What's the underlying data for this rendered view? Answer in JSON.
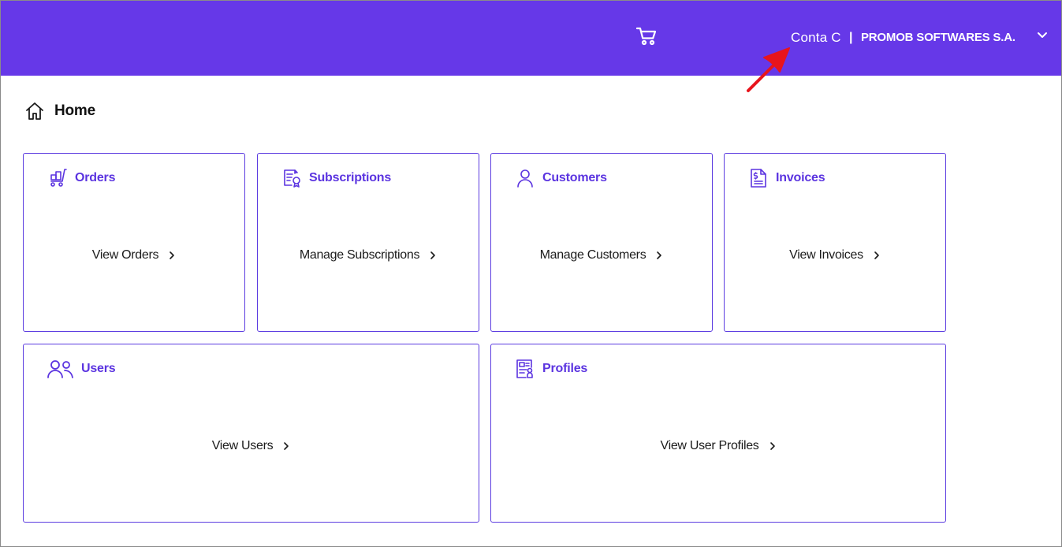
{
  "header": {
    "cart_icon": "shopping-cart-icon",
    "account_label": "Conta C",
    "separator": "|",
    "company_name": "PROMOB SOFTWARES S.A.",
    "dropdown_icon": "chevron-down-icon",
    "background_color": "#6638e8"
  },
  "breadcrumb": {
    "icon": "home-icon",
    "title": "Home"
  },
  "cards": {
    "orders": {
      "title": "Orders",
      "link": "View Orders",
      "icon": "cart-stack-icon"
    },
    "subscriptions": {
      "title": "Subscriptions",
      "link": "Manage Subscriptions",
      "icon": "document-badge-icon"
    },
    "customers": {
      "title": "Customers",
      "link": "Manage Customers",
      "icon": "person-icon"
    },
    "invoices": {
      "title": "Invoices",
      "link": "View Invoices",
      "icon": "invoice-dollar-icon"
    },
    "users": {
      "title": "Users",
      "link": "View Users",
      "icon": "users-icon"
    },
    "profiles": {
      "title": "Profiles",
      "link": "View User Profiles",
      "icon": "profile-card-icon"
    }
  },
  "colors": {
    "accent": "#5b34e0",
    "card_border": "#5b3be0",
    "annotation": "#e8141c"
  }
}
